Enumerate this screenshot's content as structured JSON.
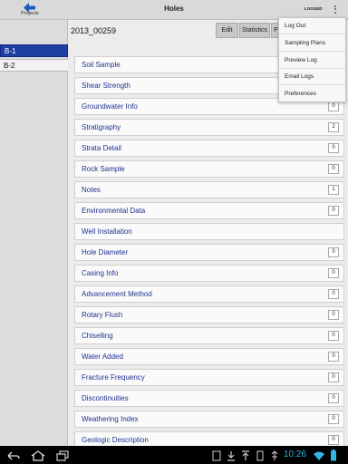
{
  "header": {
    "back_label": "Projects",
    "title": "Holes",
    "logged_label": "LOGGED",
    "overflow_icon": "overflow-menu-icon"
  },
  "sidebar": {
    "items": [
      {
        "label": "B-1",
        "selected": true
      },
      {
        "label": "B-2",
        "selected": false
      }
    ]
  },
  "main": {
    "hole_id": "2013_00259",
    "toolbar": {
      "edit_label": "Edit",
      "statistics_label": "Statistics",
      "third_label": "Pr"
    }
  },
  "menu": {
    "items": [
      "Log Out",
      "Sampling Plans",
      "Preview Log",
      "Email Logs",
      "Preferences"
    ]
  },
  "categories": [
    {
      "label": "Soil Sample",
      "count": ""
    },
    {
      "label": "Shear Strength",
      "count": ""
    },
    {
      "label": "Groundwater Info",
      "count": "0"
    },
    {
      "label": "Stratigraphy",
      "count": "2"
    },
    {
      "label": "Strata Detail",
      "count": "0"
    },
    {
      "label": "Rock Sample",
      "count": "0"
    },
    {
      "label": "Notes",
      "count": "1"
    },
    {
      "label": "Environmental Data",
      "count": "0"
    },
    {
      "label": "Well Installation",
      "count": ""
    },
    {
      "label": "Hole Diameter",
      "count": "0"
    },
    {
      "label": "Casing Info",
      "count": "0"
    },
    {
      "label": "Advancement Method",
      "count": "0"
    },
    {
      "label": "Rotary Flush",
      "count": "0"
    },
    {
      "label": "Chiselling",
      "count": "0"
    },
    {
      "label": "Water Added",
      "count": "0"
    },
    {
      "label": "Fracture Frequency",
      "count": "0"
    },
    {
      "label": "Discontinuities",
      "count": "0"
    },
    {
      "label": "Weathering Index",
      "count": "0"
    },
    {
      "label": "Geologic Description",
      "count": "0"
    }
  ],
  "system_bar": {
    "time": "10:26",
    "accent_color": "#33b5e5"
  }
}
